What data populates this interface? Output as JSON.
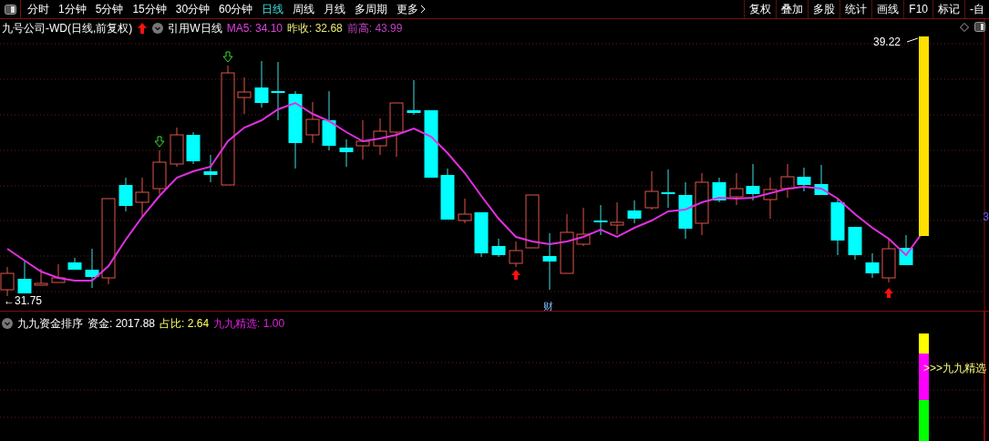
{
  "toolbar": {
    "periods": [
      {
        "label": "分时",
        "selected": false
      },
      {
        "label": "1分钟",
        "selected": false
      },
      {
        "label": "5分钟",
        "selected": false
      },
      {
        "label": "15分钟",
        "selected": false
      },
      {
        "label": "30分钟",
        "selected": false
      },
      {
        "label": "60分钟",
        "selected": false
      },
      {
        "label": "日线",
        "selected": true
      },
      {
        "label": "周线",
        "selected": false
      },
      {
        "label": "月线",
        "selected": false
      },
      {
        "label": "多周期",
        "selected": false
      },
      {
        "label": "更多",
        "selected": false
      }
    ],
    "tools": [
      "复权",
      "叠加",
      "多股",
      "统计",
      "画线",
      "F10",
      "标记",
      "-自"
    ]
  },
  "chart_header": {
    "title": "九号公司-WD(日线,前复权)",
    "reference": "引用W日线",
    "metrics": [
      {
        "text": "MA5: 34.10",
        "color": "#e040e0"
      },
      {
        "text": "昨收: 32.68",
        "color": "#e8e878"
      },
      {
        "text": "前高: 43.99",
        "color": "#c040c0"
      }
    ]
  },
  "chart": {
    "high_label": "39.22",
    "low_label": "←31.75",
    "event_marker": "财",
    "axis_fragment": "3"
  },
  "indicator": {
    "name": "九九资金排序",
    "metrics": [
      {
        "text": "资金: 2017.88",
        "color": "#ffffff"
      },
      {
        "text": "占比: 2.64",
        "color": "#ffff60"
      },
      {
        "text": "九九精选: 1.00",
        "color": "#e020e0"
      }
    ],
    "signal_label": ">>>九九精选"
  }
}
